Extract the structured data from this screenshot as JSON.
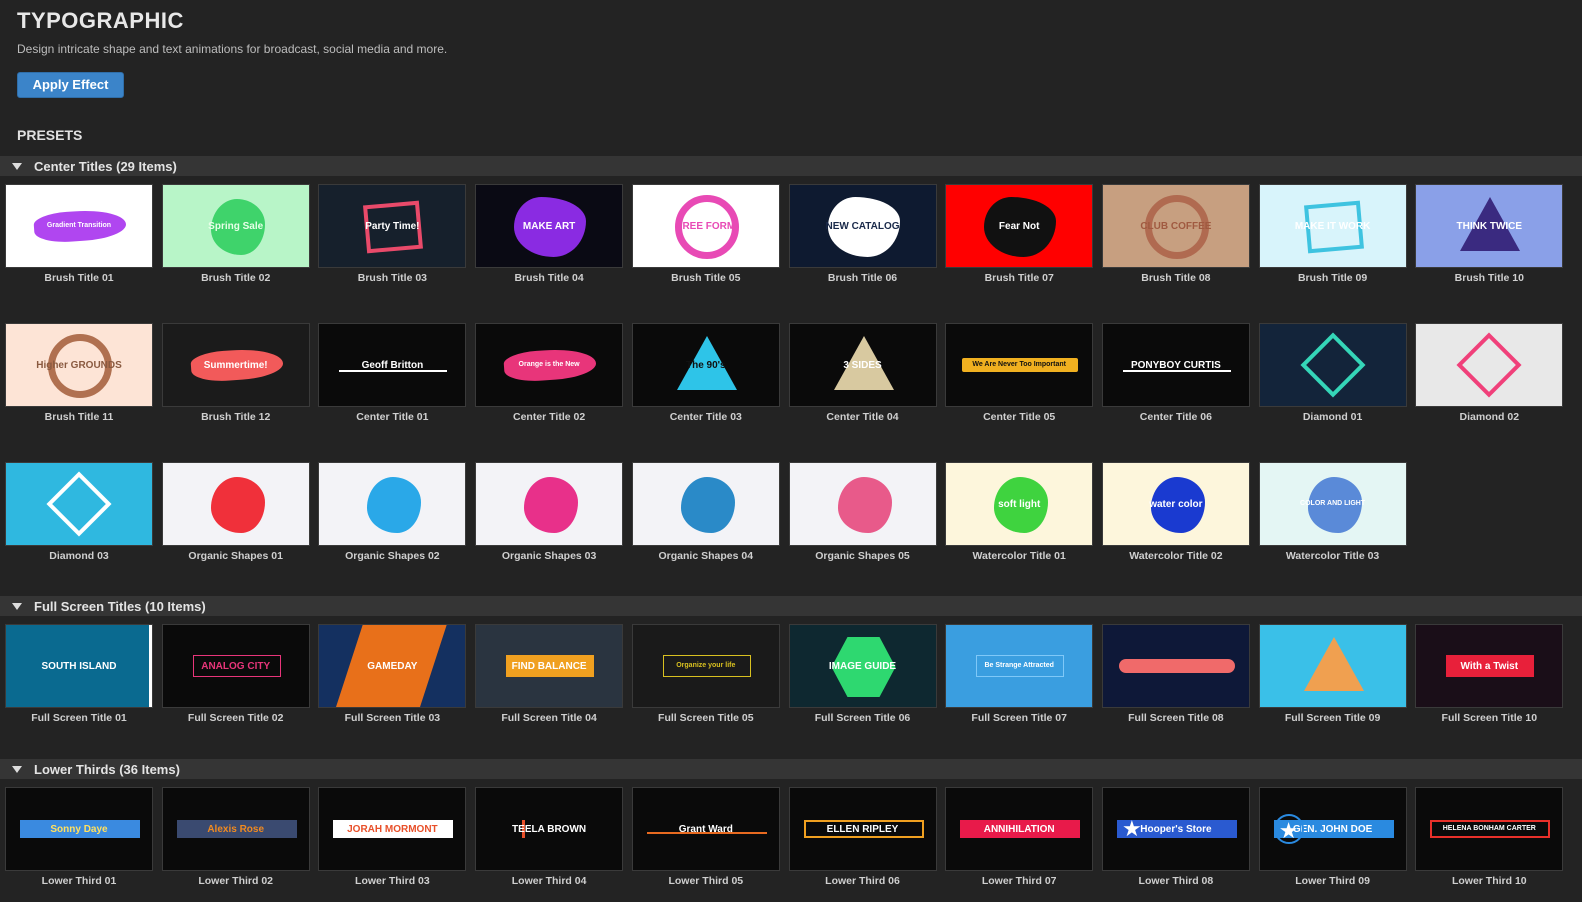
{
  "header": {
    "title": "TYPOGRAPHIC",
    "subtitle": "Design intricate shape and text animations for broadcast, social media and more.",
    "apply_label": "Apply Effect",
    "presets_label": "PRESETS"
  },
  "sections": [
    {
      "label": "Center Titles (29 Items)",
      "items": [
        {
          "name": "Brush Title 01",
          "bg": "#ffffff",
          "accent": "#b046f0",
          "shape": "brush",
          "text": "Gradient Transition",
          "fg": "#ffffff"
        },
        {
          "name": "Brush Title 02",
          "bg": "#b8f5c8",
          "accent": "#3fd36b",
          "shape": "blob",
          "text": "Spring Sale",
          "fg": "#e8ffe8"
        },
        {
          "name": "Brush Title 03",
          "bg": "#16202c",
          "accent": "#e94a6a",
          "shape": "frame",
          "text": "Party Time!",
          "fg": "#ffffff"
        },
        {
          "name": "Brush Title 04",
          "bg": "#0a0a14",
          "accent": "#8a2be2",
          "shape": "splat",
          "text": "MAKE ART",
          "fg": "#ffffff"
        },
        {
          "name": "Brush Title 05",
          "bg": "#ffffff",
          "accent": "#e84ab5",
          "shape": "ring",
          "text": "FREE FORM",
          "fg": "#e84ab5"
        },
        {
          "name": "Brush Title 06",
          "bg": "#0e1a30",
          "accent": "#ffffff",
          "shape": "splat",
          "text": "NEW CATALOG",
          "fg": "#1a2a4a"
        },
        {
          "name": "Brush Title 07",
          "bg": "#ff0000",
          "accent": "#111111",
          "shape": "splat",
          "text": "Fear Not",
          "fg": "#ffffff"
        },
        {
          "name": "Brush Title 08",
          "bg": "#c79f80",
          "accent": "#b06a50",
          "shape": "ring",
          "text": "CLUB COFFEE",
          "fg": "#a05a40"
        },
        {
          "name": "Brush Title 09",
          "bg": "#d8f4fb",
          "accent": "#3ec3e0",
          "shape": "frame",
          "text": "MAKE IT WORK",
          "fg": "#ffffff"
        },
        {
          "name": "Brush Title 10",
          "bg": "#8aa0e8",
          "accent": "#3a2a80",
          "shape": "tri",
          "text": "THINK TWICE",
          "fg": "#ffffff"
        },
        {
          "name": "Brush Title 11",
          "bg": "#fde4d6",
          "accent": "#b07050",
          "shape": "ring",
          "text": "Higher GROUNDS",
          "fg": "#8a5a40"
        },
        {
          "name": "Brush Title 12",
          "bg": "#1b1b1b",
          "accent": "#f25a5a",
          "shape": "brush",
          "text": "Summertime!",
          "fg": "#ffffff"
        },
        {
          "name": "Center Title 01",
          "bg": "#0a0a0a",
          "accent": "#ffffff",
          "shape": "line",
          "text": "Geoff Britton",
          "fg": "#ffffff"
        },
        {
          "name": "Center Title 02",
          "bg": "#0a0a0a",
          "accent": "#e8357a",
          "shape": "brush",
          "text": "Orange is the New",
          "fg": "#ffffff"
        },
        {
          "name": "Center Title 03",
          "bg": "#0a0a0a",
          "accent": "#2ec4e8",
          "shape": "tri",
          "text": "The 90's",
          "fg": "#111111"
        },
        {
          "name": "Center Title 04",
          "bg": "#0a0a0a",
          "accent": "#d8c9a0",
          "shape": "tri",
          "text": "3 SIDES",
          "fg": "#ffffff"
        },
        {
          "name": "Center Title 05",
          "bg": "#0a0a0a",
          "accent": "#f0b020",
          "shape": "bar",
          "text": "We Are Never Too Important",
          "fg": "#111111"
        },
        {
          "name": "Center Title 06",
          "bg": "#0a0a0a",
          "accent": "#ffffff",
          "shape": "line",
          "text": "PONYBOY CURTIS",
          "fg": "#ffffff"
        },
        {
          "name": "Diamond 01",
          "bg": "#13243a",
          "accent": "#35d6b8",
          "shape": "diamond",
          "text": "",
          "fg": "#ffffff"
        },
        {
          "name": "Diamond 02",
          "bg": "#e8e8e8",
          "accent": "#f0407a",
          "shape": "diamond",
          "text": "",
          "fg": "#ffffff"
        },
        {
          "name": "Diamond 03",
          "bg": "#2fb8e0",
          "accent": "#ffffff",
          "shape": "diamond",
          "text": "",
          "fg": "#ffffff"
        },
        {
          "name": "Organic Shapes 01",
          "bg": "#f3f3f7",
          "accent": "#f0303a",
          "shape": "blob",
          "text": "",
          "fg": "#ffffff"
        },
        {
          "name": "Organic Shapes 02",
          "bg": "#f3f3f7",
          "accent": "#2aa8e8",
          "shape": "blob",
          "text": "",
          "fg": "#ffffff"
        },
        {
          "name": "Organic Shapes 03",
          "bg": "#f3f3f7",
          "accent": "#e8308a",
          "shape": "blob",
          "text": "",
          "fg": "#ffffff"
        },
        {
          "name": "Organic Shapes 04",
          "bg": "#f3f3f7",
          "accent": "#2a8ac8",
          "shape": "blob",
          "text": "",
          "fg": "#ffffff"
        },
        {
          "name": "Organic Shapes 05",
          "bg": "#f3f3f7",
          "accent": "#e85a8a",
          "shape": "blob",
          "text": "",
          "fg": "#ffffff"
        },
        {
          "name": "Watercolor Title 01",
          "bg": "#fdf6dc",
          "accent": "#3fd33f",
          "shape": "blob",
          "text": "soft light",
          "fg": "#ffffff"
        },
        {
          "name": "Watercolor Title 02",
          "bg": "#fdf6dc",
          "accent": "#1a3ad0",
          "shape": "blob",
          "text": "water color",
          "fg": "#ffffff"
        },
        {
          "name": "Watercolor Title 03",
          "bg": "#e4f6f4",
          "accent": "#5a8ad8",
          "shape": "blob",
          "text": "COLOR AND LIGHT",
          "fg": "#ffffff"
        }
      ]
    },
    {
      "label": "Full Screen Titles (10 Items)",
      "items": [
        {
          "name": "Full Screen Title 01",
          "bg": "#0a6a90",
          "accent": "#ffffff",
          "shape": "fs-bottom",
          "text": "SOUTH ISLAND",
          "fg": "#ffffff"
        },
        {
          "name": "Full Screen Title 02",
          "bg": "#0a0a0a",
          "accent": "#e8357a",
          "shape": "box",
          "text": "ANALOG CITY",
          "fg": "#e8357a"
        },
        {
          "name": "Full Screen Title 03",
          "bg": "#143060",
          "accent": "#e8701a",
          "shape": "slant",
          "text": "GAMEDAY",
          "fg": "#ffffff"
        },
        {
          "name": "Full Screen Title 04",
          "bg": "#2a3440",
          "accent": "#f0a020",
          "shape": "tag",
          "text": "FIND BALANCE",
          "fg": "#ffffff"
        },
        {
          "name": "Full Screen Title 05",
          "bg": "#1a1a1a",
          "accent": "#d8c020",
          "shape": "box",
          "text": "Organize your life",
          "fg": "#d8c020"
        },
        {
          "name": "Full Screen Title 06",
          "bg": "#0e2830",
          "accent": "#2ed870",
          "shape": "hex",
          "text": "IMAGE GUIDE",
          "fg": "#ffffff"
        },
        {
          "name": "Full Screen Title 07",
          "bg": "#3a9ee0",
          "accent": "#7fc8f8",
          "shape": "box",
          "text": "Be Strange Attracted",
          "fg": "#ffffff"
        },
        {
          "name": "Full Screen Title 08",
          "bg": "#0e1838",
          "accent": "#f06a6a",
          "shape": "pill",
          "text": "",
          "fg": "#ffffff"
        },
        {
          "name": "Full Screen Title 09",
          "bg": "#3ac0e8",
          "accent": "#f0a050",
          "shape": "tri",
          "text": "",
          "fg": "#ffffff"
        },
        {
          "name": "Full Screen Title 10",
          "bg": "#1a0e18",
          "accent": "#e8203a",
          "shape": "tag",
          "text": "With a Twist",
          "fg": "#ffffff"
        }
      ]
    },
    {
      "label": "Lower Thirds (36 Items)",
      "items": [
        {
          "name": "Lower Third 01",
          "bg": "#0a0a0a",
          "accent": "#3a8ae0",
          "shape": "lt",
          "text": "Sonny Daye",
          "fg": "#ffe060"
        },
        {
          "name": "Lower Third 02",
          "bg": "#0a0a0a",
          "accent": "#3a4a70",
          "shape": "lt",
          "text": "Alexis Rose",
          "fg": "#f08a20"
        },
        {
          "name": "Lower Third 03",
          "bg": "#0a0a0a",
          "accent": "#ffffff",
          "shape": "lt",
          "text": "JORAH MORMONT",
          "fg": "#e8502a"
        },
        {
          "name": "Lower Third 04",
          "bg": "#0a0a0a",
          "accent": "#e8502a",
          "shape": "lt-bar",
          "text": "TEELA BROWN",
          "fg": "#ffffff"
        },
        {
          "name": "Lower Third 05",
          "bg": "#0a0a0a",
          "accent": "#e86a20",
          "shape": "lt-line",
          "text": "Grant Ward",
          "fg": "#ffffff"
        },
        {
          "name": "Lower Third 06",
          "bg": "#0a0a0a",
          "accent": "#f0a020",
          "shape": "lt-box",
          "text": "ELLEN RIPLEY",
          "fg": "#ffffff"
        },
        {
          "name": "Lower Third 07",
          "bg": "#0a0a0a",
          "accent": "#e81a4a",
          "shape": "lt",
          "text": "ANNIHILATION",
          "fg": "#ffffff"
        },
        {
          "name": "Lower Third 08",
          "bg": "#0a0a0a",
          "accent": "#2a5ad0",
          "shape": "lt-star",
          "text": "Hooper's Store",
          "fg": "#ffffff"
        },
        {
          "name": "Lower Third 09",
          "bg": "#0a0a0a",
          "accent": "#2a8ae0",
          "shape": "lt-circle",
          "text": "GEN. JOHN DOE",
          "fg": "#ffffff"
        },
        {
          "name": "Lower Third 10",
          "bg": "#0a0a0a",
          "accent": "#e8302a",
          "shape": "lt-box",
          "text": "HELENA BONHAM CARTER",
          "fg": "#ffffff"
        }
      ]
    }
  ]
}
